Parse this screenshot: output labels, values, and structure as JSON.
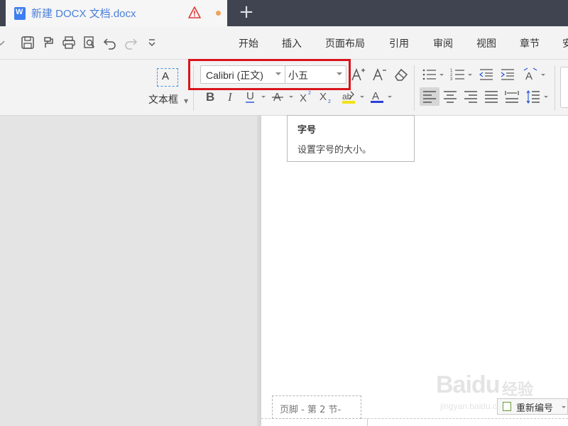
{
  "tab": {
    "title": "新建 DOCX 文档.docx",
    "doc_icon": "word-doc-icon",
    "warn_icon": "warning-icon",
    "modified_color": "#f0a35a",
    "accent_color": "#4a7fd8"
  },
  "new_tab_symbol": "+",
  "quick_access": [
    "save-icon",
    "format-painter-icon",
    "print-icon",
    "print-preview-icon",
    "undo-icon",
    "redo-icon",
    "more-dropdown-icon"
  ],
  "menu": {
    "items": [
      "开始",
      "插入",
      "页面布局",
      "引用",
      "审阅",
      "视图",
      "章节",
      "安"
    ]
  },
  "ribbon": {
    "textbox_label": "文本框",
    "textbox_icon_glyph": "A",
    "font_name": "Calibri (正文)",
    "font_size": "小五",
    "highlight_color": "#d9141c"
  },
  "tooltip": {
    "title": "字号",
    "description": "设置字号的大小。"
  },
  "footer": {
    "tag": "页脚  - 第 2 节-",
    "renumber_label": "重新编号"
  },
  "watermark": {
    "logo": "Bai",
    "logo2": "du",
    "cn": "经验",
    "url": "jingyan.baidu.com"
  }
}
